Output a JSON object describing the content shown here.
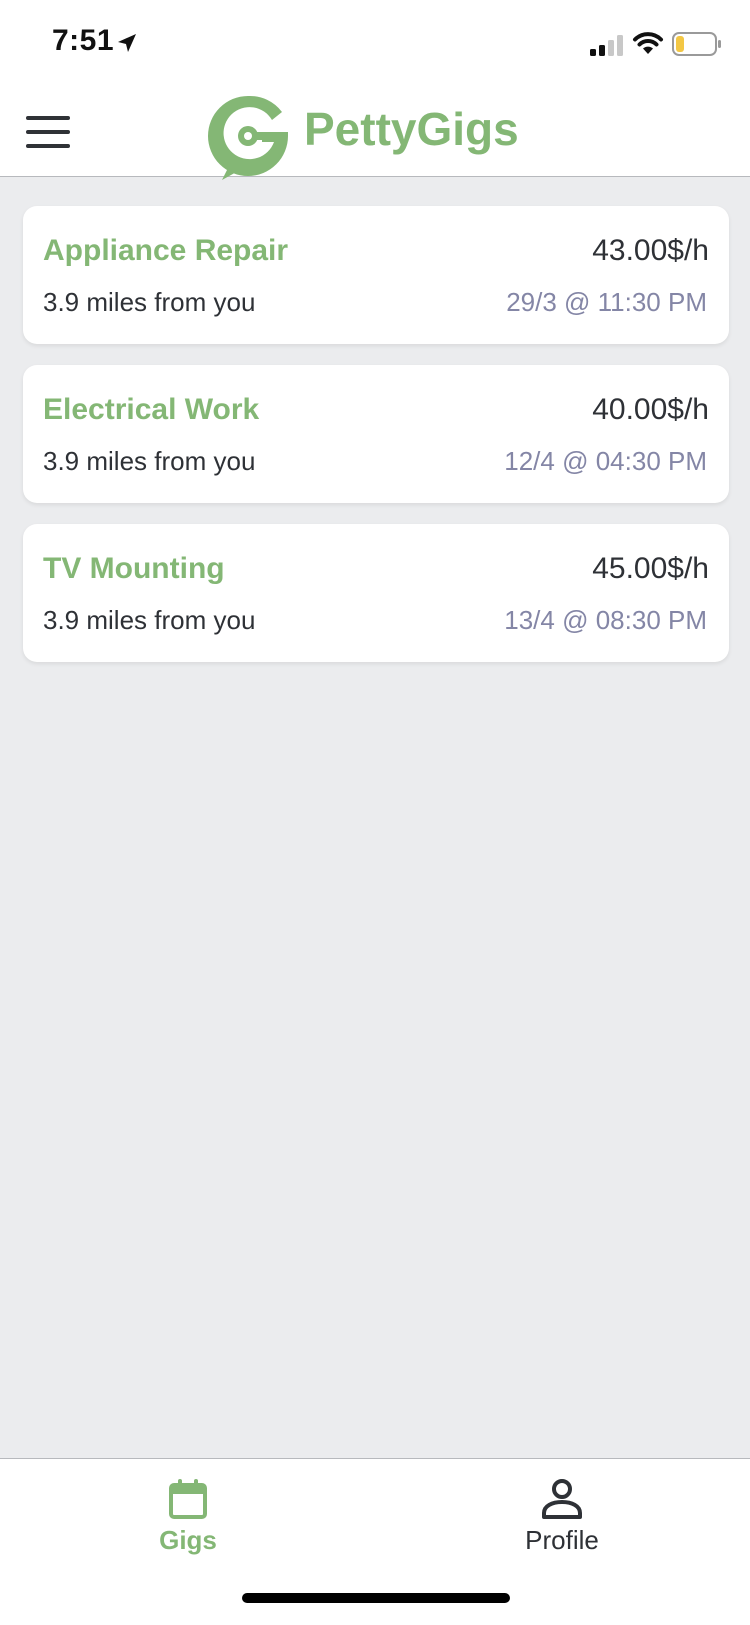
{
  "status_bar": {
    "time": "7:51"
  },
  "header": {
    "app_name": "PettyGigs"
  },
  "gigs": [
    {
      "title": "Appliance Repair",
      "rate": "43.00$/h",
      "distance": "3.9 miles from you",
      "datetime": "29/3 @ 11:30 PM"
    },
    {
      "title": "Electrical Work",
      "rate": "40.00$/h",
      "distance": "3.9 miles from you",
      "datetime": "12/4 @ 04:30 PM"
    },
    {
      "title": "TV Mounting",
      "rate": "45.00$/h",
      "distance": "3.9 miles from you",
      "datetime": "13/4 @ 08:30 PM"
    }
  ],
  "tab_bar": {
    "tabs": [
      {
        "label": "Gigs",
        "icon": "calendar-icon",
        "active": true
      },
      {
        "label": "Profile",
        "icon": "person-icon",
        "active": false
      }
    ]
  },
  "colors": {
    "brand_green": "#84b775",
    "text_dark": "#2e3136",
    "date_gray": "#8486a6",
    "background": "#ebecee",
    "battery_low": "#f3c744"
  }
}
